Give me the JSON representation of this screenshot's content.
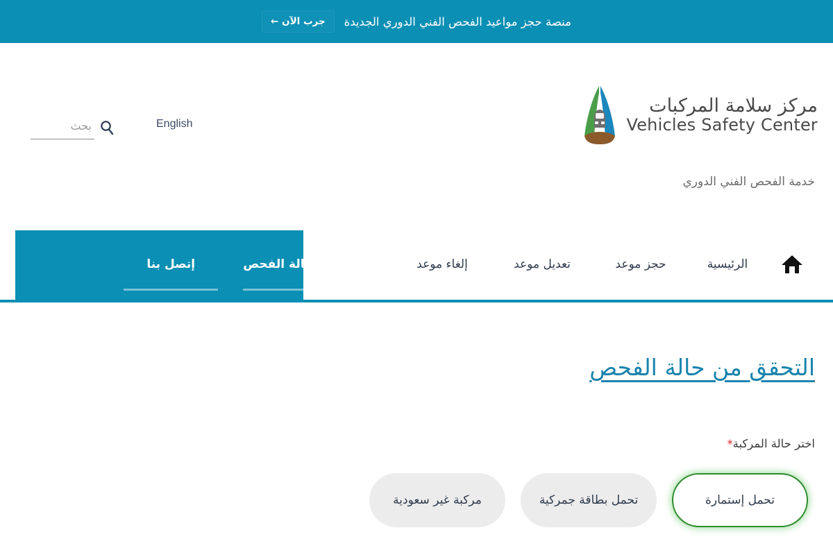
{
  "promo": {
    "text": "منصة حجز مواعيد الفحص الفني الدوري الجديدة",
    "cta_label": "جرب الآن ←",
    "background": "#0b8fb4"
  },
  "header": {
    "brand_ar": "مركز سلامة المركبات",
    "brand_en": "Vehicles Safety Center",
    "service_subtitle": "خدمة الفحص الفني الدوري",
    "logo_icon": "vehicle-safety-arch-logo",
    "logo_colors": {
      "left_arc": "#4a9e4a",
      "right_arc": "#1b87bd",
      "base": "#8a5a2b",
      "car": "#6e6e6e"
    }
  },
  "utility": {
    "language_label": "English",
    "search_placeholder": "بحث",
    "search_value": "",
    "search_icon": "search-icon"
  },
  "nav": {
    "home_icon": "home-icon",
    "accent": "#0b8fb4",
    "items": [
      {
        "label": "الرئيسية",
        "active": false
      },
      {
        "label": "حجز موعد",
        "active": false
      },
      {
        "label": "تعديل موعد",
        "active": false
      },
      {
        "label": "إلغاء موعد",
        "active": false
      },
      {
        "label": "التحقق من حالة الفحص",
        "active": true
      },
      {
        "label": "إتصل بنا",
        "active": true
      }
    ]
  },
  "main": {
    "page_title": "التحقق من حالة الفحص",
    "field_label": "اختر حالة المركبة",
    "required_marker": "*",
    "options": [
      {
        "label": "تحمل إستمارة",
        "selected": true
      },
      {
        "label": "تحمل بطاقة جمركية",
        "selected": false
      },
      {
        "label": "مركبة غير سعودية",
        "selected": false
      }
    ],
    "selected_color": "#2e8b2e"
  }
}
